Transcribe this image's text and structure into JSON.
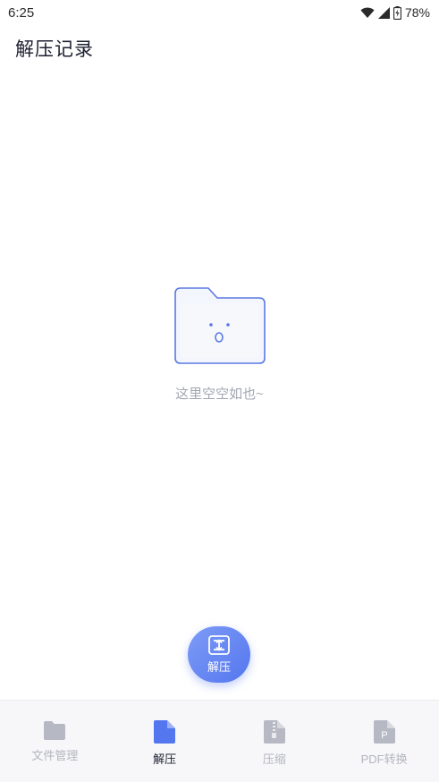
{
  "status_bar": {
    "time": "6:25",
    "battery": "78%"
  },
  "header": {
    "title": "解压记录"
  },
  "empty_state": {
    "message": "这里空空如也~"
  },
  "fab": {
    "label": "解压"
  },
  "bottom_nav": {
    "items": [
      {
        "label": "文件管理",
        "icon": "folder-icon",
        "active": false
      },
      {
        "label": "解压",
        "icon": "file-icon",
        "active": true
      },
      {
        "label": "压缩",
        "icon": "zip-file-icon",
        "active": false
      },
      {
        "label": "PDF转换",
        "icon": "pdf-file-icon",
        "active": false
      }
    ]
  },
  "colors": {
    "accent": "#5476ee",
    "inactive": "#b3b6bf",
    "muted_text": "#a3a7b3"
  }
}
